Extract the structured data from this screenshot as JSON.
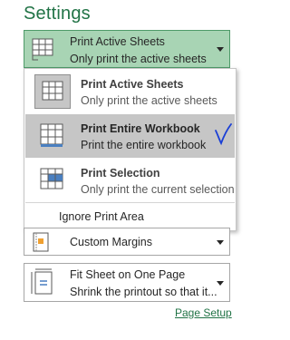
{
  "settings": {
    "title": "Settings"
  },
  "print_what": {
    "selected_label": "Print Active Sheets",
    "selected_desc": "Only print the active sheets",
    "options": [
      {
        "label": "Print Active Sheets",
        "desc": "Only print the active sheets",
        "icon": "active-sheets-icon"
      },
      {
        "label": "Print Entire Workbook",
        "desc": "Print the entire workbook",
        "icon": "entire-workbook-icon",
        "highlighted": true
      },
      {
        "label": "Print Selection",
        "desc": "Only print the current selection",
        "icon": "selection-icon"
      }
    ],
    "ignore_print_area": "Ignore Print Area"
  },
  "margins": {
    "label": "Custom Margins"
  },
  "scaling": {
    "label": "Fit Sheet on One Page",
    "desc": "Shrink the printout so that it..."
  },
  "links": {
    "page_setup": "Page Setup"
  },
  "colors": {
    "accent": "#217346",
    "selected_combo": "#a8d4b4",
    "highlight_row": "#c6c6c6",
    "checkmark": "#1a3fd6"
  }
}
